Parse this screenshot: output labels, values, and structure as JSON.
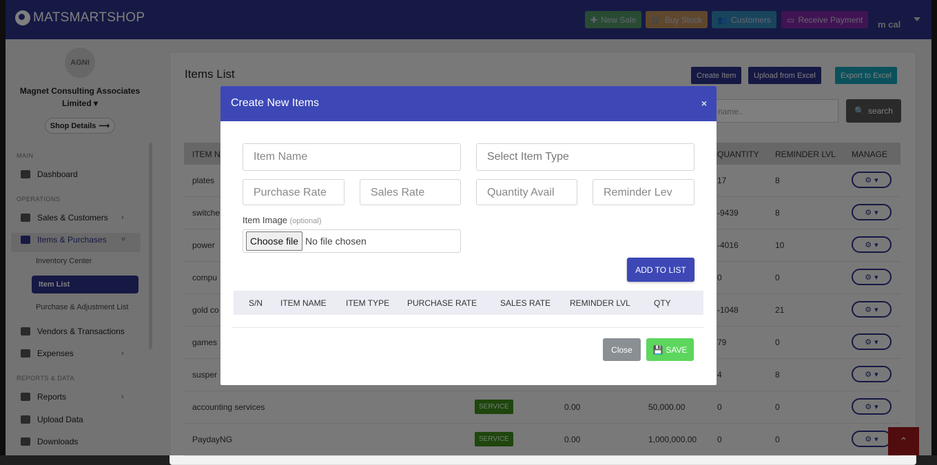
{
  "brand": {
    "name": "MATSMARTSHOP"
  },
  "topbar": {
    "buttons": [
      {
        "label": "New Sale",
        "icon": "plus-icon",
        "color": "#5cb85c"
      },
      {
        "label": "Buy Stock",
        "icon": "cart-icon",
        "color": "#f0ad4e"
      },
      {
        "label": "Customers",
        "icon": "users-icon",
        "color": "#36a9c9"
      },
      {
        "label": "Receive Payment",
        "icon": "card-icon",
        "color": "#9c27b0"
      }
    ],
    "user": "m cal"
  },
  "sidebar": {
    "logo_text": "AGNI",
    "business_name": "Magnet Consulting Associates Limited",
    "shop_details": "Shop Details",
    "sections": {
      "main": "MAIN",
      "operations": "OPERATIONS",
      "reports": "REPORTS & DATA"
    },
    "items": {
      "dashboard": "Dashboard",
      "sales_customers": "Sales & Customers",
      "items_purchases": "Items & Purchases",
      "inventory_center": "Inventory Center",
      "item_list": "Item List",
      "purchase_adjustment": "Purchase & Adjustment List",
      "vendors": "Vendors & Transactions",
      "expenses": "Expenses",
      "reports": "Reports",
      "upload_data": "Upload Data",
      "downloads": "Downloads"
    }
  },
  "page": {
    "title": "Items List",
    "buttons": {
      "create": "Create Item",
      "upload": "Upload from Excel",
      "export": "Export to Excel"
    },
    "search_placeholder": "name..",
    "search_button": "search",
    "columns": {
      "item_name": "ITEM N",
      "quantity": "QUANTITY",
      "reminder": "REMINDER LVL",
      "manage": "MANAGE"
    },
    "rows": [
      {
        "name": "plates",
        "type": "",
        "purchase": "",
        "sales": "",
        "qty": "17",
        "reminder": "8"
      },
      {
        "name": "switche",
        "type": "",
        "purchase": "",
        "sales": "",
        "qty": "-9439",
        "reminder": "8"
      },
      {
        "name": "power",
        "type": "",
        "purchase": "",
        "sales": "",
        "qty": "-4016",
        "reminder": "10"
      },
      {
        "name": "compu",
        "type": "",
        "purchase": "",
        "sales": "",
        "qty": "0",
        "reminder": "0"
      },
      {
        "name": "gold co",
        "type": "",
        "purchase": "",
        "sales": "",
        "qty": "-1048",
        "reminder": "21"
      },
      {
        "name": "games",
        "type": "",
        "purchase": "",
        "sales": "",
        "qty": "79",
        "reminder": "0"
      },
      {
        "name": "susper",
        "type": "",
        "purchase": "",
        "sales": "",
        "qty": "4",
        "reminder": "8"
      },
      {
        "name": "accounting services",
        "type": "SERVICE",
        "purchase": "0.00",
        "sales": "50,000.00",
        "qty": "0",
        "reminder": "0"
      },
      {
        "name": "PaydayNG",
        "type": "SERVICE",
        "purchase": "0.00",
        "sales": "1,000,000.00",
        "qty": "0",
        "reminder": "0"
      }
    ]
  },
  "modal": {
    "title": "Create New Items",
    "close_symbol": "×",
    "placeholders": {
      "item_name": "Item Name",
      "item_type": "Select Item Type",
      "purchase_rate": "Purchase Rate",
      "sales_rate": "Sales Rate",
      "quantity": "Quantity Avail",
      "reminder": "Reminder Lev"
    },
    "image_label": "Item Image",
    "image_optional": "(optional)",
    "file_button": "Choose file",
    "file_status": "No file chosen",
    "add_button": "ADD TO LIST",
    "table_headers": [
      "S/N",
      "ITEM NAME",
      "ITEM TYPE",
      "PURCHASE RATE",
      "SALES RATE",
      "REMINDER LVL",
      "QTY"
    ],
    "close_button": "Close",
    "save_button": "SAVE"
  }
}
